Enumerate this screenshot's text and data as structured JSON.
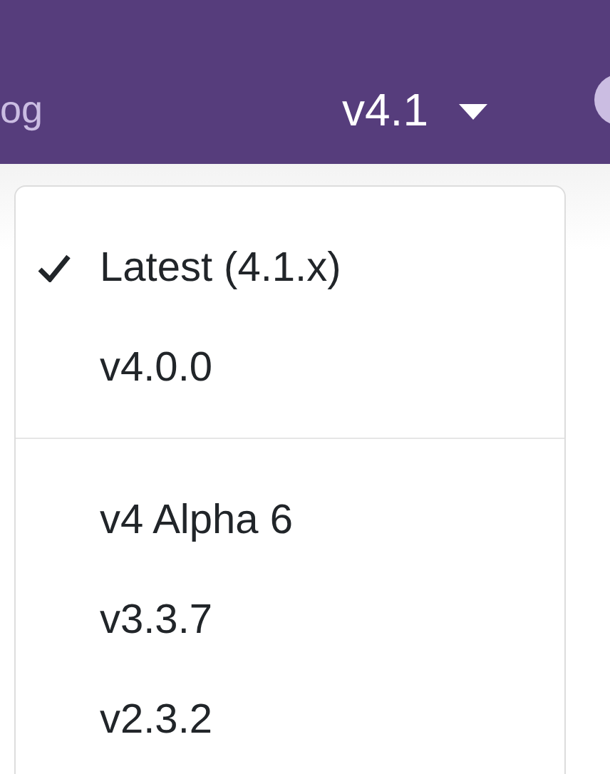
{
  "navbar": {
    "nav_link": "og",
    "version_toggle": "v4.1"
  },
  "version_menu": {
    "groups": [
      [
        {
          "label": "Latest (4.1.x)",
          "selected": true
        },
        {
          "label": "v4.0.0",
          "selected": false
        }
      ],
      [
        {
          "label": "v4 Alpha 6",
          "selected": false
        },
        {
          "label": "v3.3.7",
          "selected": false
        },
        {
          "label": "v2.3.2",
          "selected": false
        }
      ]
    ]
  }
}
